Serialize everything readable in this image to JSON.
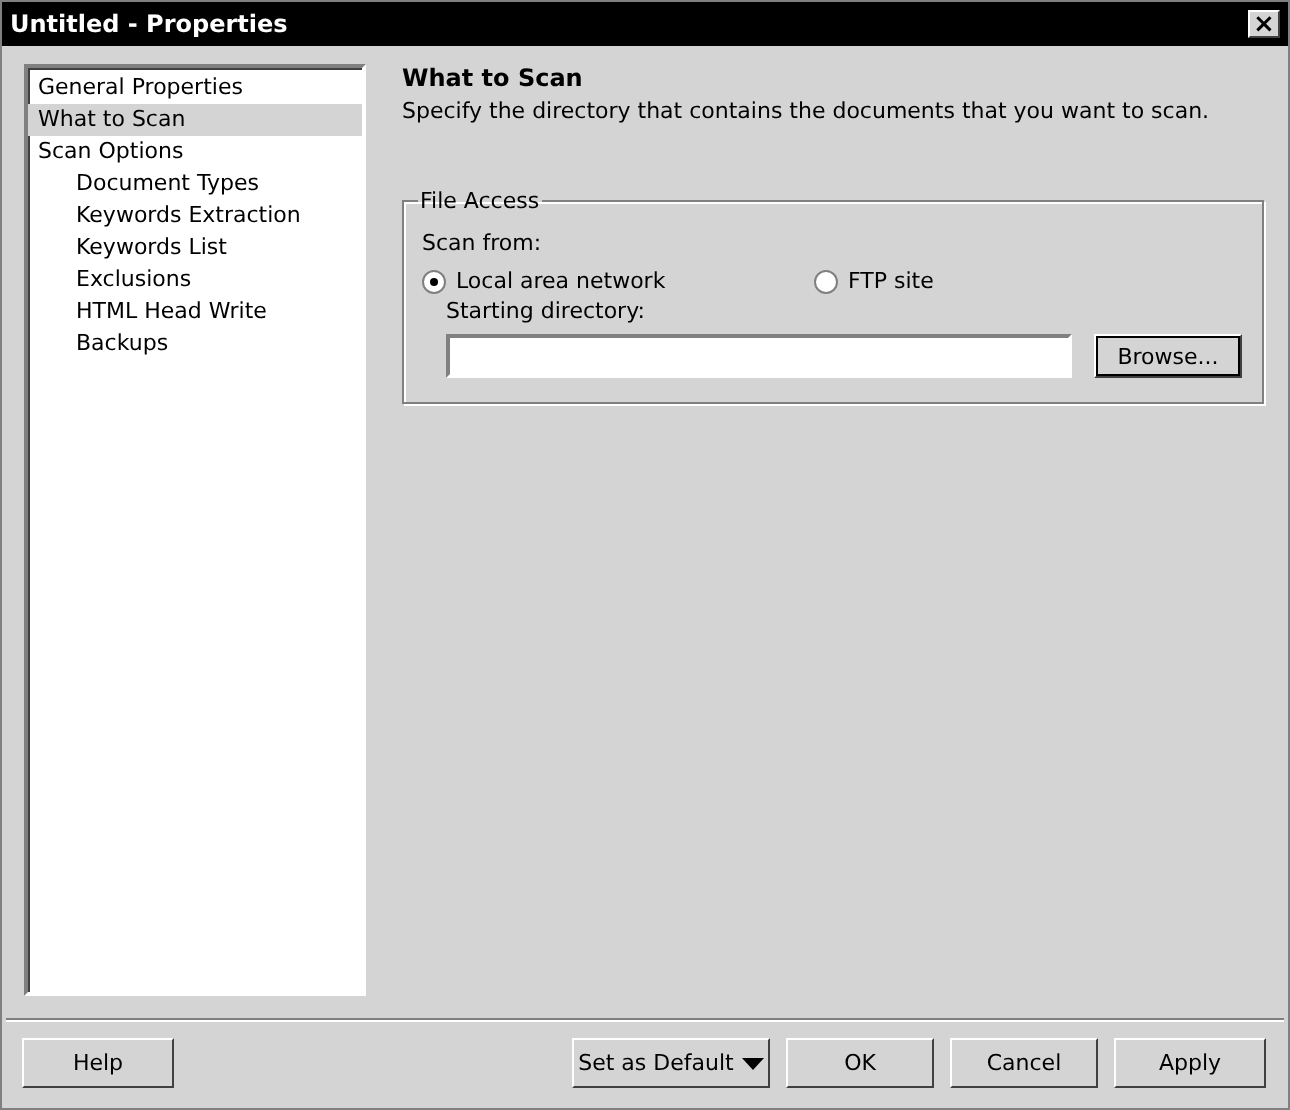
{
  "window": {
    "title": "Untitled - Properties",
    "close": "×"
  },
  "sidebar": {
    "items": [
      {
        "label": "General Properties",
        "selected": false
      },
      {
        "label": "What to Scan",
        "selected": true
      },
      {
        "label": "Scan Options",
        "selected": false,
        "children": [
          {
            "label": "Document Types",
            "selected": false
          },
          {
            "label": "Keywords Extraction",
            "selected": false
          },
          {
            "label": "Keywords List",
            "selected": false
          },
          {
            "label": "Exclusions",
            "selected": false
          },
          {
            "label": "HTML Head Write",
            "selected": false
          },
          {
            "label": "Backups",
            "selected": false
          }
        ]
      }
    ]
  },
  "page": {
    "title": "What to Scan",
    "description": "Specify the directory that contains the documents that you want to scan.",
    "group": {
      "title": "File Access",
      "scan_from_label": "Scan from:",
      "options": [
        {
          "label": "Local area network",
          "selected": true
        },
        {
          "label": "FTP site",
          "selected": false
        }
      ],
      "directory_label": "Starting directory:",
      "browse": "Browse..."
    }
  },
  "buttons": [
    {
      "label": "Help",
      "kind": "plain"
    },
    {
      "label": "Set as Default",
      "kind": "dropdown"
    },
    {
      "label": "OK",
      "kind": "plain"
    },
    {
      "label": "Cancel",
      "kind": "plain"
    },
    {
      "label": "Apply",
      "kind": "plain"
    }
  ]
}
